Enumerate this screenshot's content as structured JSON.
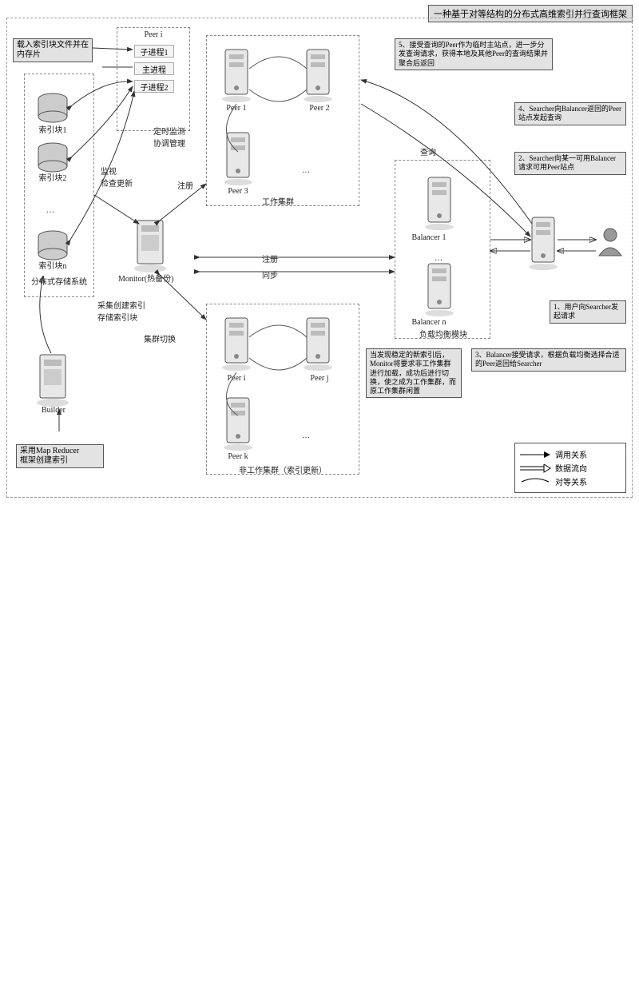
{
  "title": "一种基于对等结构的分布式高维索引并行查询框架",
  "left": {
    "load_note": "载入索引块文件并在内存片",
    "peer_i": "Peer i",
    "sub1": "子进程1",
    "main": "主进程",
    "sub2": "子进程2",
    "idx1": "索引块1",
    "idx2": "索引块2",
    "idxn": "索引块n",
    "dots": "…",
    "dist_storage": "分布式存储系统",
    "monitor_note": "监视\n检查更新",
    "builder": "Builder",
    "builder_note": "采集创建索引\n存储索引块",
    "map_reducer_note": "采用Map Reducer\n框架创建索引"
  },
  "center": {
    "peer1": "Peer 1",
    "peer2": "Peer 2",
    "peer3": "Peer 3",
    "work_cluster": "工作集群",
    "timer_note": "定时监测\n协调管理",
    "register": "注册",
    "register2": "注册",
    "sync": "同步",
    "monitor": "Monitor(热备份)",
    "switch_note": "集群切换",
    "peer_i2": "Peer i",
    "peer_j": "Peer j",
    "peer_k": "Peer k",
    "inactive_cluster": "非工作集群（索引更新）",
    "switch_detail": "当发现稳定的新索引后，Monitor将要求非工作集群进行加载，成功后进行切换，使之成为工作集群，而原工作集群闲置"
  },
  "right": {
    "step5": "5、接受查询的Peer作为临时主站点，进一步分发查询请求，获得本地及其他Peer的查询结果并聚合后返回",
    "query": "查询",
    "balancer1": "Balancer 1",
    "balancern": "Balancer n",
    "lb_module": "负载均衡模块",
    "step4": "4、Searcher向Balancer返回的Peer站点发起查询",
    "step2": "2、Searcher向某一可用Balancer请求可用Peer站点",
    "step1": "1、用户向Searcher发起请求",
    "step3": "3、Balancer接受请求，根据负载均衡选择合适的Peer返回给Searcher",
    "dots": "…"
  },
  "legend": {
    "call": "调用关系",
    "data": "数据流向",
    "peer": "对等关系"
  }
}
